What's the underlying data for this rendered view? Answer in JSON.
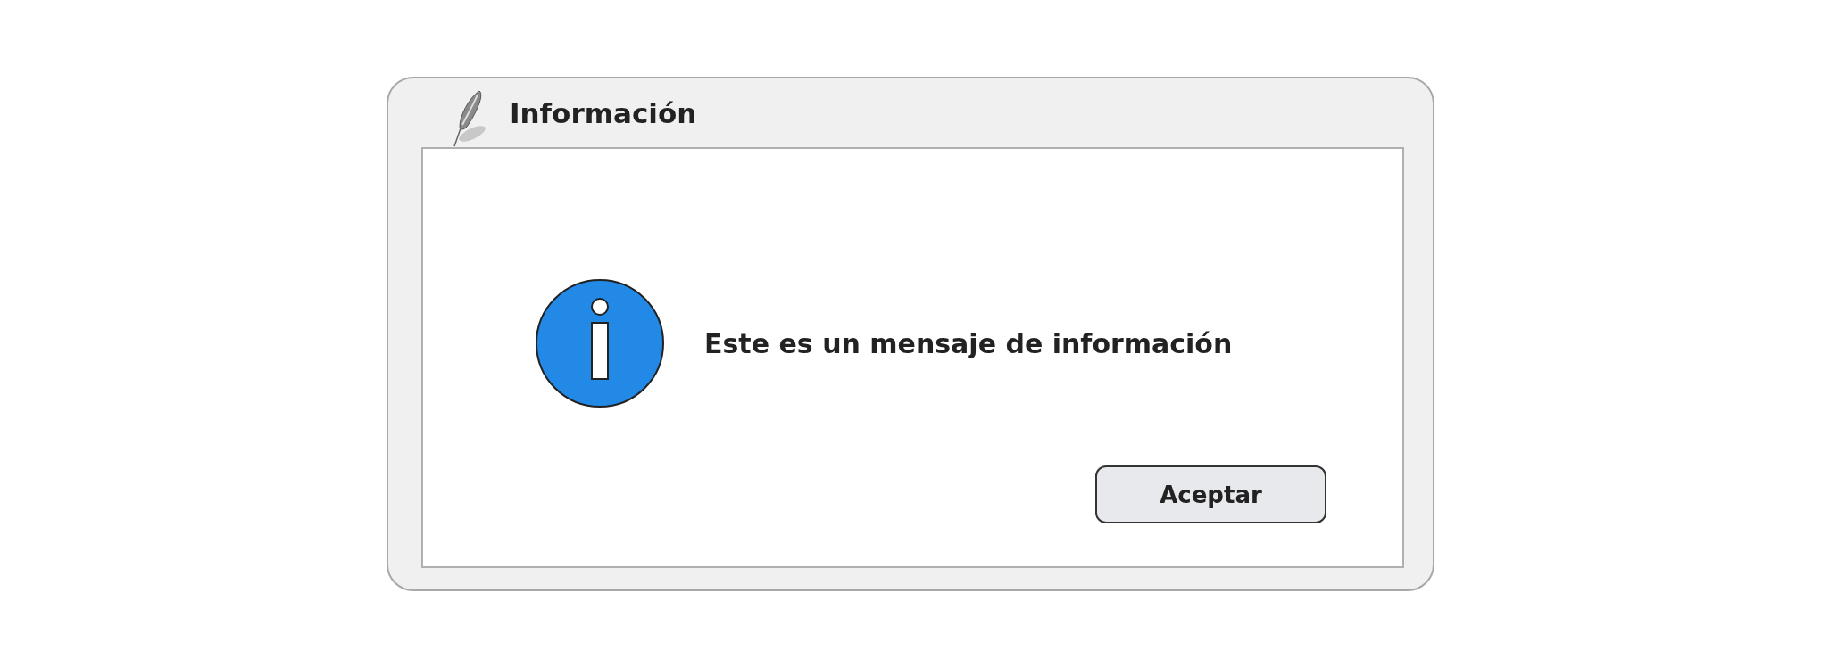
{
  "window": {
    "title": "Información"
  },
  "message": "Este es un mensaje de información",
  "buttons": [
    "Aceptar"
  ]
}
